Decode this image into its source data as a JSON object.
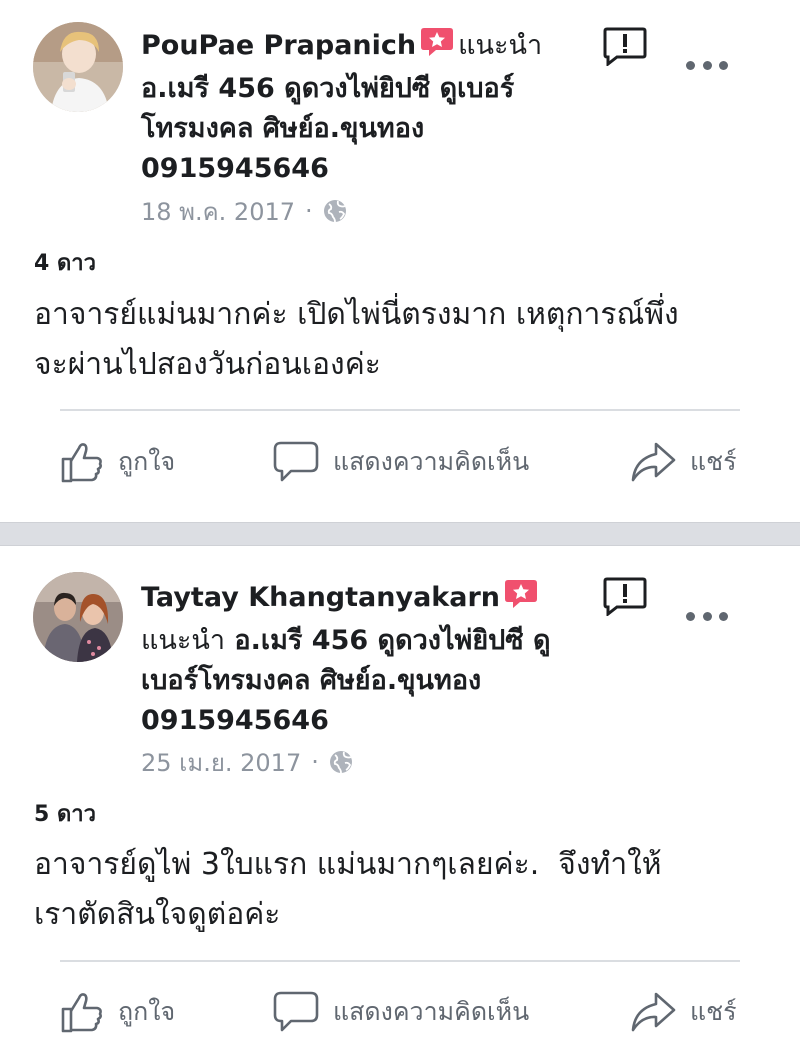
{
  "colors": {
    "text": "#1c1e21",
    "muted": "#8d949e",
    "action": "#606770",
    "badge": "#f0506e",
    "separator": "#dcdee3"
  },
  "posts": [
    {
      "author": "PouPae Prapanich",
      "recommend_word": "แนะนำ",
      "page_line1": "อ.เมรี 456 ดูดวงไพ่ยิปซี ดูเบอร์",
      "page_line2": "โทรมงคล ศิษย์อ.ขุนทอง",
      "page_line3": "0915945646",
      "date": "18 พ.ค. 2017",
      "dot": "·",
      "rating": "4 ดาว",
      "review_line1": "อาจารย์แม่นมากค่ะ เปิดไพ่นี่ตรงมาก เหตุการณ์พึ่ง",
      "review_line2": "จะผ่านไปสองวันก่อนเองค่ะ",
      "like_label": "ถูกใจ",
      "comment_label": "แสดงความคิดเห็น",
      "share_label": "แชร์"
    },
    {
      "author": "Taytay Khangtanyakarn",
      "recommend_word": "แนะนำ",
      "page_line1": "อ.เมรี 456 ดูดวงไพ่ยิปซี ดู",
      "page_line2": "เบอร์โทรมงคล ศิษย์อ.ขุนทอง",
      "page_line3": "0915945646",
      "date": "25 เม.ย. 2017",
      "dot": "·",
      "rating": "5 ดาว",
      "review_line1": "อาจารย์ดูไพ่ 3ใบแรก แม่นมากๆเลยค่ะ.  จึงทำให้",
      "review_line2": "เราตัดสินใจดูต่อค่ะ",
      "like_label": "ถูกใจ",
      "comment_label": "แสดงความคิดเห็น",
      "share_label": "แชร์"
    }
  ],
  "icons": {
    "recommend": "recommend-star-badge-icon",
    "report": "report-flag-icon",
    "more": "more-options-icon",
    "globe": "globe-icon",
    "like": "thumbs-up-icon",
    "comment": "comment-bubble-icon",
    "share": "share-arrow-icon"
  }
}
